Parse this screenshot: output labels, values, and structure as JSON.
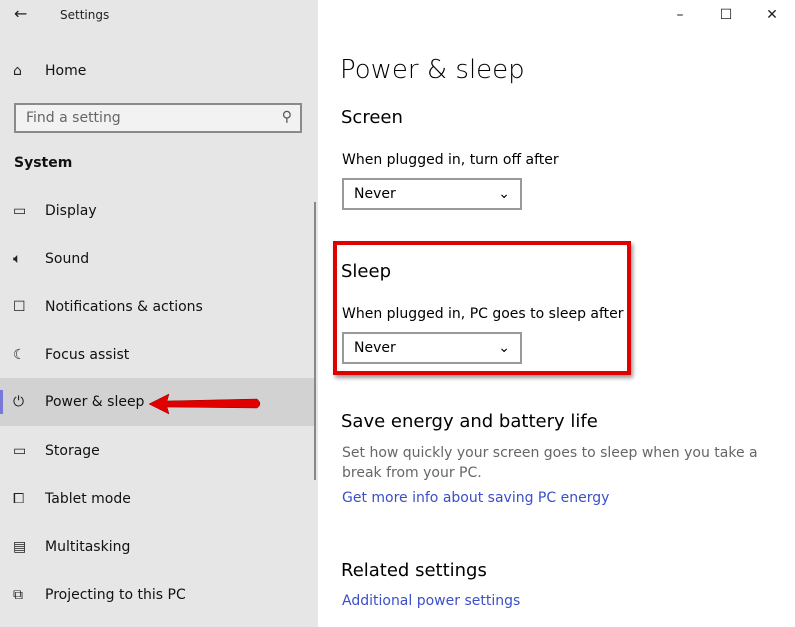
{
  "window": {
    "title": "Settings",
    "controls": [
      "minimize",
      "maximize",
      "close"
    ]
  },
  "sidebar": {
    "home": "Home",
    "search_placeholder": "Find a setting",
    "section": "System",
    "items": [
      {
        "label": "Display",
        "icon": "monitor-icon"
      },
      {
        "label": "Sound",
        "icon": "speaker-icon"
      },
      {
        "label": "Notifications & actions",
        "icon": "notification-icon"
      },
      {
        "label": "Focus assist",
        "icon": "moon-icon"
      },
      {
        "label": "Power & sleep",
        "icon": "power-icon",
        "selected": true
      },
      {
        "label": "Storage",
        "icon": "storage-icon"
      },
      {
        "label": "Tablet mode",
        "icon": "tablet-icon"
      },
      {
        "label": "Multitasking",
        "icon": "multitasking-icon"
      },
      {
        "label": "Projecting to this PC",
        "icon": "projecting-icon"
      }
    ]
  },
  "main": {
    "title": "Power & sleep",
    "screen": {
      "heading": "Screen",
      "label": "When plugged in, turn off after",
      "value": "Never"
    },
    "sleep": {
      "heading": "Sleep",
      "label": "When plugged in, PC goes to sleep after",
      "value": "Never"
    },
    "save": {
      "heading": "Save energy and battery life",
      "desc": "Set how quickly your screen goes to sleep when you take a break from your PC.",
      "link": "Get more info about saving PC energy"
    },
    "related": {
      "heading": "Related settings",
      "link": "Additional power settings"
    }
  },
  "annotation": {
    "color": "#e00000"
  },
  "accent": "#7878d8"
}
